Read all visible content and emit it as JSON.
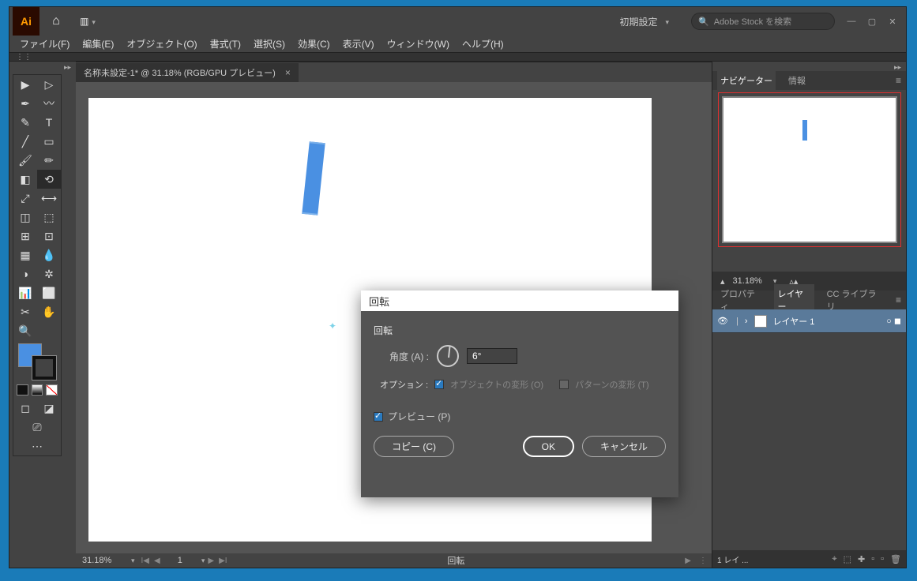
{
  "titlebar": {
    "app_abbr": "Ai",
    "workspace_label": "初期設定",
    "search_placeholder": "Adobe Stock を検索"
  },
  "menu": {
    "file": "ファイル(F)",
    "edit": "編集(E)",
    "object": "オブジェクト(O)",
    "type": "書式(T)",
    "select": "選択(S)",
    "effect": "効果(C)",
    "view": "表示(V)",
    "window": "ウィンドウ(W)",
    "help": "ヘルプ(H)"
  },
  "doc_tab": {
    "title": "名称未設定-1* @ 31.18% (RGB/GPU プレビュー)",
    "close": "×"
  },
  "status": {
    "zoom": "31.18%",
    "artboard_index": "1",
    "tool_name": "回転"
  },
  "panels": {
    "navigator_tab": "ナビゲーター",
    "info_tab": "情報",
    "nav_zoom": "31.18%",
    "property_tab": "プロパティ",
    "layer_tab": "レイヤー",
    "cc_lib_tab": "CC ライブラリ",
    "layer_name": "レイヤー 1",
    "layer_status": "1 レイ ..."
  },
  "dialog": {
    "title": "回転",
    "group_label": "回転",
    "angle_label": "角度 (A) :",
    "angle_value": "6°",
    "option_label": "オプション :",
    "transform_objects": "オブジェクトの変形 (O)",
    "transform_patterns": "パターンの変形 (T)",
    "preview_label": "プレビュー (P)",
    "copy_btn": "コピー (C)",
    "ok_btn": "OK",
    "cancel_btn": "キャンセル"
  },
  "colors": {
    "fill": "#4a90e2",
    "stroke": "#111111"
  }
}
